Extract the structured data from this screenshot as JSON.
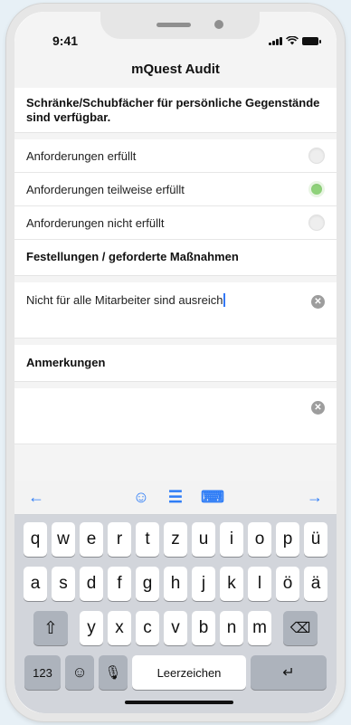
{
  "status": {
    "time": "9:41"
  },
  "nav": {
    "title": "mQuest Audit"
  },
  "question": {
    "title": "Schränke/Schubfächer für persönliche Gegenstände sind verfügbar.",
    "options": [
      {
        "label": "Anforderungen erfüllt",
        "selected": false
      },
      {
        "label": "Anforderungen teilweise erfüllt",
        "selected": true
      },
      {
        "label": "Anforderungen nicht erfüllt",
        "selected": false
      }
    ]
  },
  "findings": {
    "title": "Festellungen / geforderte Maßnahmen",
    "value": "Nicht für alle Mitarbeiter sind ausreich"
  },
  "notes": {
    "title": "Anmerkungen",
    "value": ""
  },
  "keyboard": {
    "row1": [
      "q",
      "w",
      "e",
      "r",
      "t",
      "z",
      "u",
      "i",
      "o",
      "p",
      "ü"
    ],
    "row2": [
      "a",
      "s",
      "d",
      "f",
      "g",
      "h",
      "j",
      "k",
      "l",
      "ö",
      "ä"
    ],
    "row3": [
      "y",
      "x",
      "c",
      "v",
      "b",
      "n",
      "m"
    ],
    "numbers_label": "123",
    "space_label": "Leerzeichen"
  },
  "colors": {
    "accent": "#2f7df6",
    "selected_radio": "#8fd27a"
  }
}
